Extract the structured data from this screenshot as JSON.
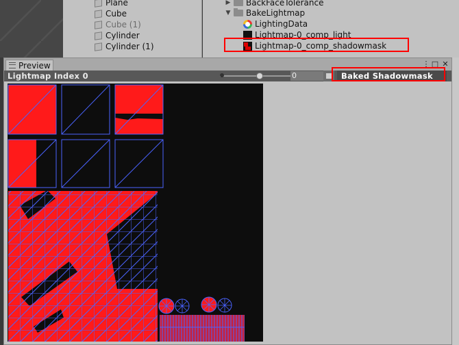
{
  "hierarchy": {
    "items": [
      {
        "label": "Plane",
        "dim": false
      },
      {
        "label": "Cube",
        "dim": false
      },
      {
        "label": "Cube (1)",
        "dim": true
      },
      {
        "label": "Cylinder",
        "dim": false
      },
      {
        "label": "Cylinder (1)",
        "dim": false
      }
    ]
  },
  "project": {
    "items": [
      {
        "label": "BackFaceTolerance",
        "kind": "folder",
        "expanded": false
      },
      {
        "label": "BakeLightmap",
        "kind": "folder",
        "expanded": true
      },
      {
        "label": "LightingData",
        "kind": "lighting-data"
      },
      {
        "label": "Lightmap-0_comp_light",
        "kind": "texture"
      },
      {
        "label": "Lightmap-0_comp_shadowmask",
        "kind": "texture-shadowmask"
      }
    ]
  },
  "preview": {
    "tab_label": "Preview",
    "title": "Lightmap Index 0",
    "slider_value": "0",
    "slider_fraction": 0.56,
    "mode_dropdown": "Baked Shadowmask"
  },
  "colors": {
    "shadowmask_red": "#ff1a1a",
    "wireframe_blue": "#4a63ff",
    "lightmap_background": "#0d0d0d",
    "highlight_red": "#ff0000",
    "toolbar_dark": "#585858"
  },
  "icons": {
    "tab": "preview-menu-icon",
    "window_buttons": [
      "context-menu-icon",
      "maximize-icon",
      "close-icon"
    ]
  }
}
